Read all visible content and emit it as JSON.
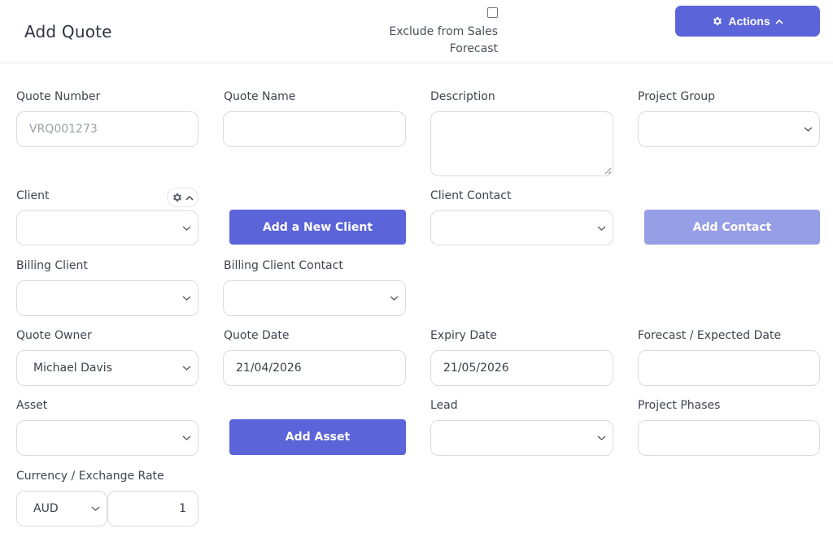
{
  "header": {
    "title": "Add Quote",
    "exclude_label": "Exclude from Sales Forecast",
    "exclude_checked": false,
    "actions_label": "Actions",
    "actions_icon": "gear-icon"
  },
  "form": {
    "quote_number": {
      "label": "Quote Number",
      "placeholder": "VRQ001273"
    },
    "quote_name": {
      "label": "Quote Name",
      "value": ""
    },
    "description": {
      "label": "Description",
      "value": ""
    },
    "project_group": {
      "label": "Project Group",
      "value": ""
    },
    "client": {
      "label": "Client",
      "value": "",
      "settings_icon": "gear-icon"
    },
    "add_client_button": "Add a New Client",
    "client_contact": {
      "label": "Client Contact",
      "value": ""
    },
    "add_contact_button": "Add Contact",
    "billing_client": {
      "label": "Billing Client",
      "value": ""
    },
    "billing_client_contact": {
      "label": "Billing Client Contact",
      "value": ""
    },
    "quote_owner": {
      "label": "Quote Owner",
      "value": "Michael Davis"
    },
    "quote_date": {
      "label": "Quote Date",
      "value": "21/04/2026"
    },
    "expiry_date": {
      "label": "Expiry Date",
      "value": "21/05/2026"
    },
    "forecast_date": {
      "label": "Forecast / Expected Date",
      "value": ""
    },
    "asset": {
      "label": "Asset",
      "value": ""
    },
    "add_asset_button": "Add Asset",
    "lead": {
      "label": "Lead",
      "value": ""
    },
    "project_phases": {
      "label": "Project Phases",
      "value": ""
    },
    "currency": {
      "label": "Currency / Exchange Rate",
      "value": "AUD",
      "rate": "1"
    }
  },
  "colors": {
    "accent": "#5b64d8",
    "accent_disabled": "#969ee6",
    "border": "#d8dbe2"
  }
}
